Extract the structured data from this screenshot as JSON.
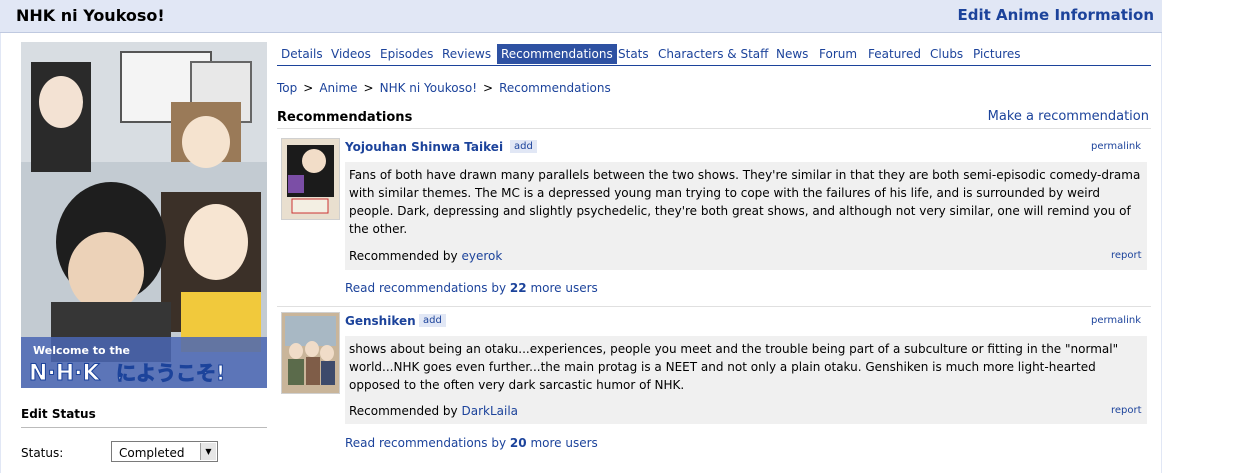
{
  "header": {
    "title": "NHK ni Youkoso!",
    "edit_link": "Edit Anime Information"
  },
  "tabs": [
    "Details",
    "Videos",
    "Episodes",
    "Reviews",
    "Recommendations",
    "Stats",
    "Characters & Staff",
    "News",
    "Forum",
    "Featured",
    "Clubs",
    "Pictures"
  ],
  "active_tab": "Recommendations",
  "breadcrumb": [
    "Top",
    "Anime",
    "NHK ni Youkoso!",
    "Recommendations"
  ],
  "section": {
    "heading": "Recommendations",
    "make_rec": "Make a recommendation"
  },
  "poster": {
    "logo_text_line1": "Welcome to the",
    "logo_text_line2": "N·H·K",
    "logo_text_line3": "にようこそ!"
  },
  "recommendations": [
    {
      "title": "Yojouhan Shinwa Taikei",
      "add_label": "add",
      "permalink": "permalink",
      "text": "Fans of both have drawn many parallels between the two shows. They're similar in that they are both semi-episodic comedy-drama with similar themes. The MC is a depressed young man trying to cope with the failures of his life, and is surrounded by weird people. Dark, depressing and slightly psychedelic, they're both great shows, and although not very similar, one will remind you of the other.",
      "recommended_by_prefix": "Recommended by",
      "user": "eyerok",
      "report": "report",
      "read_more_prefix": "Read recommendations by",
      "read_more_count": "22",
      "read_more_suffix": "more users"
    },
    {
      "title": "Genshiken",
      "add_label": "add",
      "permalink": "permalink",
      "text": "shows about being an otaku...experiences, people you meet and the trouble being part of a subculture or fitting in the \"normal\" world...NHK goes even further...the main protag is a NEET and not only a plain otaku. Genshiken is much more light-hearted opposed to the often very dark sarcastic humor of NHK.",
      "recommended_by_prefix": "Recommended by",
      "user": "DarkLaila",
      "report": "report",
      "read_more_prefix": "Read recommendations by",
      "read_more_count": "20",
      "read_more_suffix": "more users"
    }
  ],
  "edit_status": {
    "heading": "Edit Status",
    "status_label": "Status:",
    "status_value": "Completed"
  },
  "colors": {
    "header_bg": "#e1e7f5",
    "link": "#1c439b",
    "active_tab_bg": "#2e51a2",
    "rec_box_bg": "#f0f0f0"
  }
}
